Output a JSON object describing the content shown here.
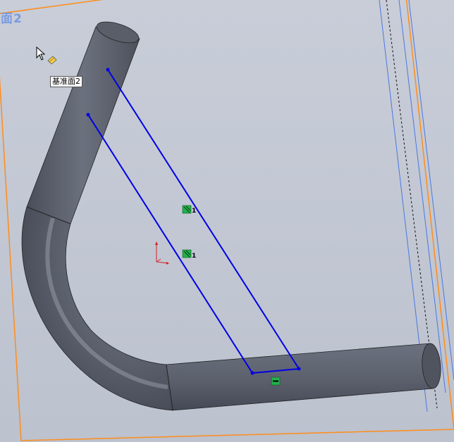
{
  "viewport": {
    "plane_label": "面2",
    "tooltip": "基准面2"
  },
  "relations": {
    "parallel_1": "1",
    "parallel_2": "1"
  },
  "colors": {
    "background": "#c3c8d4",
    "tube": "#5a5e6a",
    "sketch_line": "#0000e6",
    "plane_border": "#ff8c1a",
    "plane_inner": "#4a78e0",
    "relation_icon": "#22b14c",
    "triad_red": "#d02020"
  },
  "icons": {
    "cursor": "arrow-pointer-icon",
    "plane_cursor": "plane-select-icon",
    "relation_parallel": "parallel-relation-icon",
    "relation_horizontal": "horizontal-relation-icon",
    "triad": "coordinate-triad-icon"
  }
}
